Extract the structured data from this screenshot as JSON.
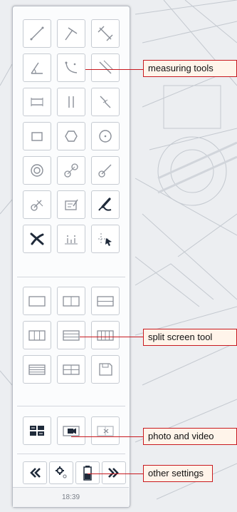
{
  "annotations": {
    "measuring": "measuring tools",
    "split": "split screen tool",
    "photo": "photo and video",
    "other": "other settings"
  },
  "status": {
    "time": "18:39"
  },
  "colors": {
    "icon_gray": "#8a8f98",
    "icon_dark": "#1f2a3a",
    "annotation_red": "#c8191f",
    "annotation_fill": "#fff4ea"
  },
  "tool_icons": [
    "line-tool-icon",
    "perpendicular-line-icon",
    "distance-measure-icon",
    "angle-icon",
    "arc-curve-icon",
    "parallel-distance-icon",
    "horizontal-lines-icon",
    "vertical-lines-icon",
    "diagonal-lines-icon",
    "rectangle-icon",
    "hexagon-icon",
    "circle-icon",
    "concentric-circles-icon",
    "circle-distance-icon",
    "radius-icon",
    "point-to-circle-icon",
    "text-annotation-icon",
    "freehand-draw-icon",
    "delete-icon",
    "point-count-icon",
    "coordinate-cursor-icon"
  ],
  "split_icons": [
    "single-view-icon",
    "split-vertical-2-icon",
    "split-horizontal-2-icon",
    "split-vertical-3-icon",
    "split-horizontal-3-icon",
    "split-vertical-4-icon",
    "split-horizontal-4-icon",
    "split-grid-4-icon",
    "save-layout-icon"
  ],
  "media_icons": [
    "photo-compare-icon",
    "video-record-icon",
    "video-split-icon"
  ],
  "settings_icons": [
    "previous-icon",
    "gear-settings-icon",
    "battery-icon",
    "next-icon"
  ]
}
